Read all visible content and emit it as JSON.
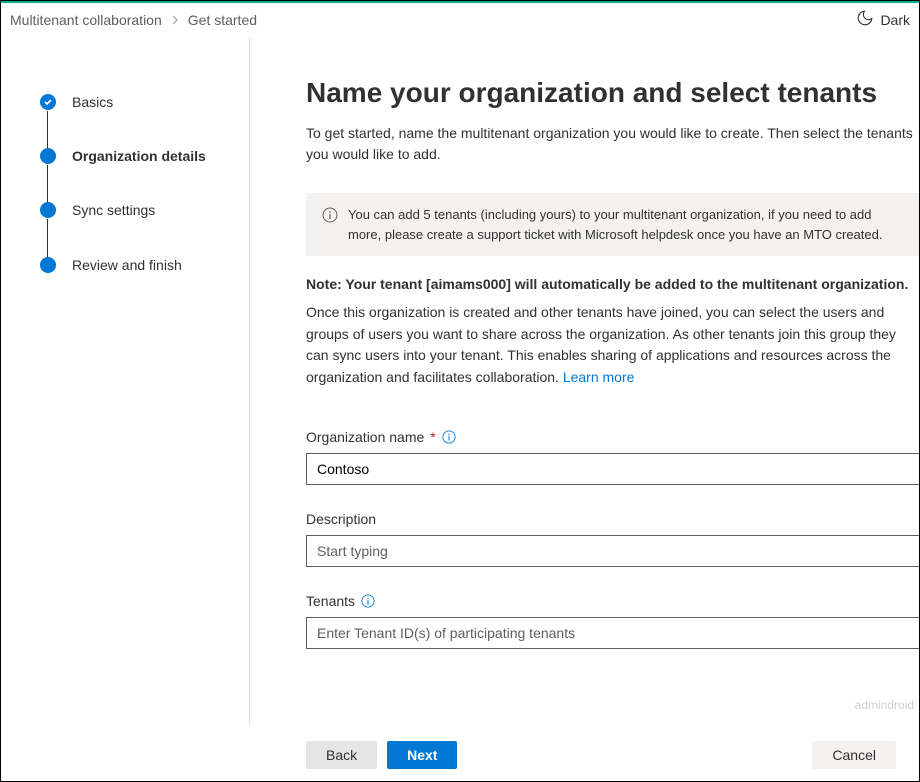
{
  "breadcrumb": {
    "root": "Multitenant collaboration",
    "current": "Get started"
  },
  "theme_toggle_label": "Dark",
  "sidebar": {
    "steps": [
      {
        "label": "Basics"
      },
      {
        "label": "Organization details"
      },
      {
        "label": "Sync settings"
      },
      {
        "label": "Review and finish"
      }
    ]
  },
  "page": {
    "title": "Name your organization and select tenants",
    "subtitle": "To get started, name the multitenant organization you would like to create. Then select the tenants you would like to add.",
    "info_text": "You can add 5 tenants (including yours) to your multitenant organization, if you need to add more, please create a support ticket with Microsoft helpdesk once you have an MTO created.",
    "note": "Note: Your tenant [aimams000] will automatically be added to the multitenant organization.",
    "body_text": "Once this organization is created and other tenants have joined, you can select the users and groups of users you want to share across the organization. As other tenants join this group they can sync users into your tenant. This enables sharing of applications and resources across the organization and facilitates collaboration. ",
    "learn_more": "Learn more"
  },
  "form": {
    "org_name_label": "Organization name",
    "org_name_value": "Contoso",
    "description_label": "Description",
    "description_placeholder": "Start typing",
    "tenants_label": "Tenants",
    "tenants_placeholder": "Enter Tenant ID(s) of participating tenants"
  },
  "footer": {
    "back": "Back",
    "next": "Next",
    "cancel": "Cancel"
  },
  "watermark": "admindroid"
}
